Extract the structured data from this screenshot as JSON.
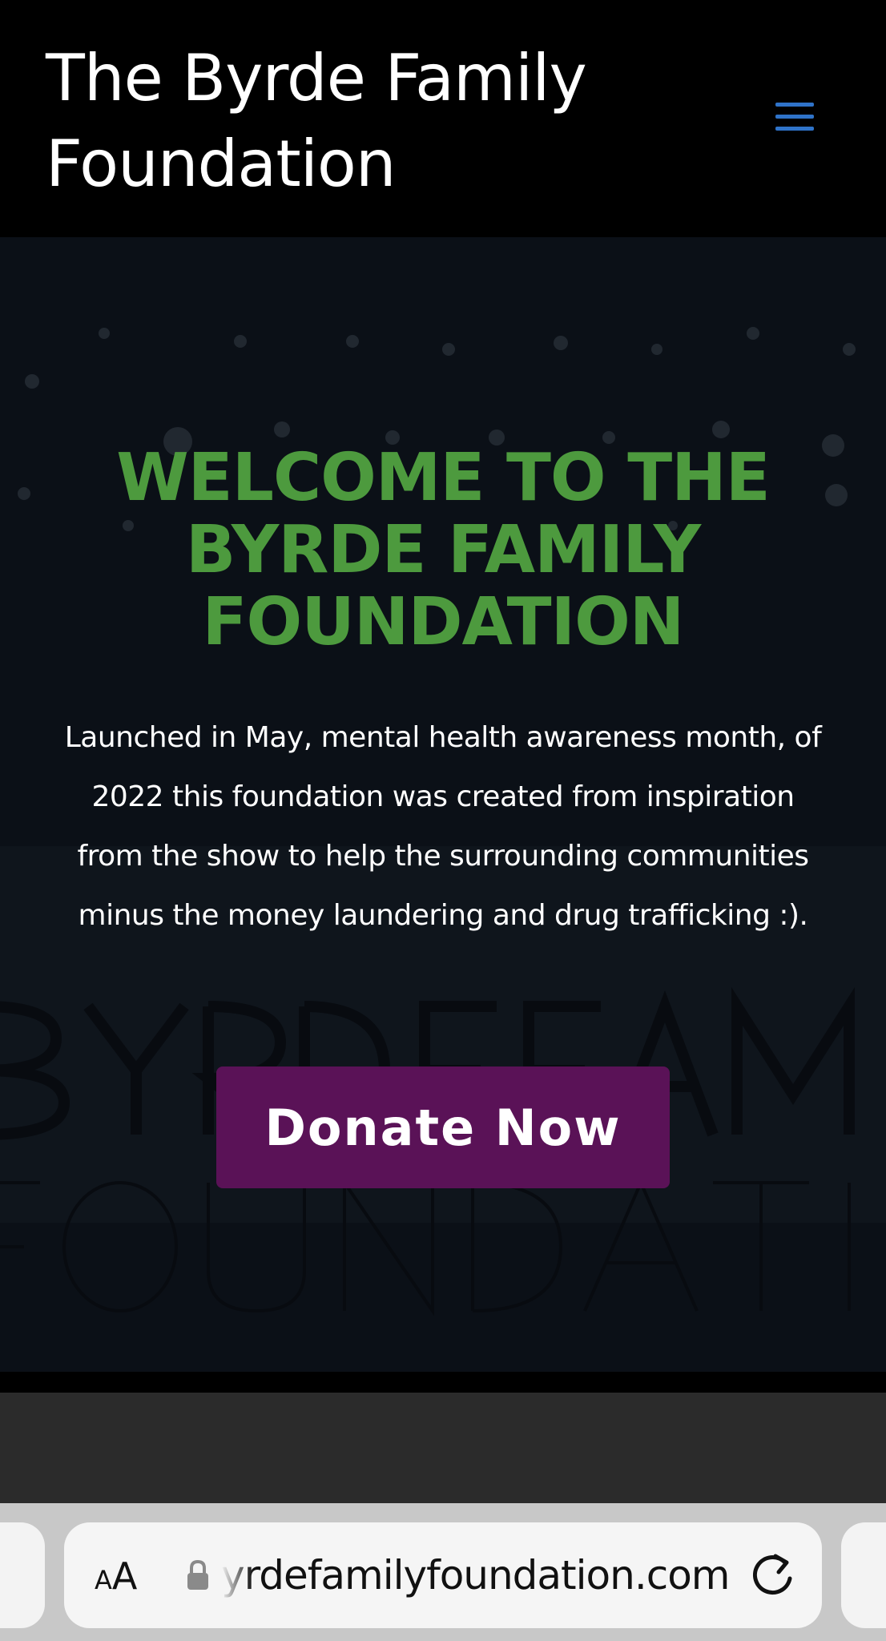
{
  "header": {
    "title": "The Byrde Family Foundation",
    "menu_icon": "hamburger-menu-icon"
  },
  "hero": {
    "heading": "WELCOME TO THE BYRDE FAMILY FOUNDATION",
    "description": "Launched in May, mental health awareness month, of 2022 this foundation was created from inspiration from the show to help the surrounding communities minus the money laundering and drug trafficking :).",
    "donate_label": "Donate Now"
  },
  "browser": {
    "text_size_label_small": "A",
    "text_size_label_large": "A",
    "url": "yrdefamilyfoundation.com",
    "lock_icon": "lock-icon",
    "reload_icon": "reload-icon"
  },
  "colors": {
    "heading_green": "#4d9a3e",
    "donate_purple": "#5a1257",
    "menu_blue": "#2f73c9"
  }
}
